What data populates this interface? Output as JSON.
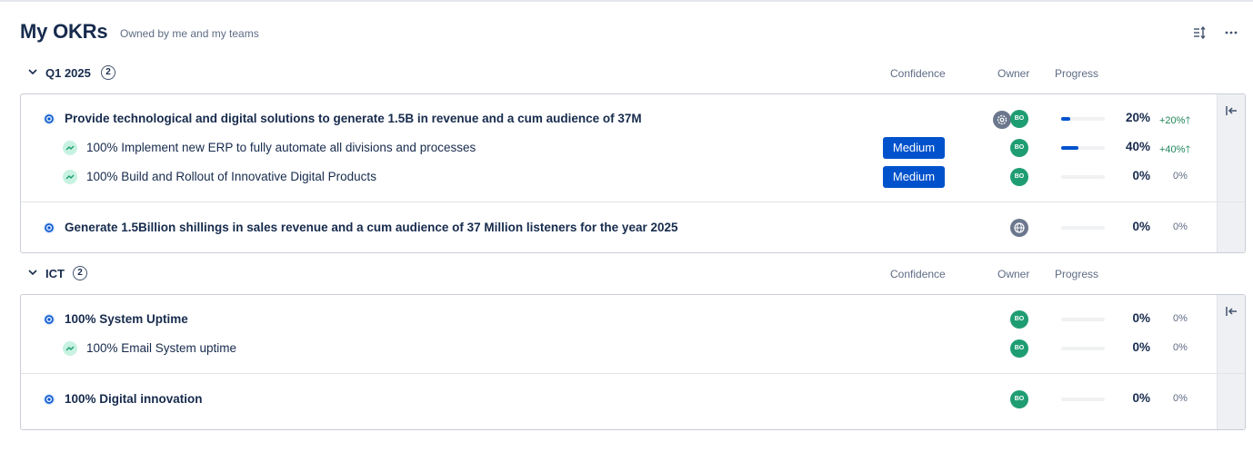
{
  "header": {
    "title": "My OKRs",
    "subtitle": "Owned by me and my teams",
    "sort_icon": "sort-icon",
    "more_icon": "more-horizontal-icon"
  },
  "columns": {
    "confidence": "Confidence",
    "owner": "Owner",
    "progress": "Progress"
  },
  "groups": [
    {
      "name": "Q1 2025",
      "count": "2",
      "objectives": [
        {
          "title": "Provide technological and digital solutions to generate 1.5B in revenue and a cum audience of 37M",
          "owners": [
            {
              "type": "team",
              "text": ""
            },
            {
              "type": "user",
              "text": "BO"
            }
          ],
          "progress": 0.2,
          "progress_label": "20%",
          "delta": "+20%",
          "key_results": [
            {
              "title": "100% Implement new ERP to fully automate all divisions and processes",
              "confidence": "Medium",
              "owner": "BO",
              "progress": 0.4,
              "progress_label": "40%",
              "delta": "+40%"
            },
            {
              "title": "100% Build and Rollout of Innovative Digital Products",
              "confidence": "Medium",
              "owner": "BO",
              "progress": 0,
              "progress_label": "0%",
              "delta": "0%"
            }
          ]
        },
        {
          "title": "Generate 1.5Billion shillings in sales revenue and a cum audience of 37 Million listeners for the year 2025",
          "owners": [
            {
              "type": "org",
              "text": ""
            }
          ],
          "progress": 0,
          "progress_label": "0%",
          "delta": "0%",
          "key_results": []
        }
      ]
    },
    {
      "name": "ICT",
      "count": "2",
      "objectives": [
        {
          "title": "100% System Uptime",
          "owners": [
            {
              "type": "user",
              "text": "BO"
            }
          ],
          "progress": 0,
          "progress_label": "0%",
          "delta": "0%",
          "key_results": [
            {
              "title": "100% Email System uptime",
              "confidence": "",
              "owner": "BO",
              "progress": 0,
              "progress_label": "0%",
              "delta": "0%"
            }
          ]
        },
        {
          "title": "100% Digital innovation",
          "owners": [
            {
              "type": "user",
              "text": "BO"
            }
          ],
          "progress": 0,
          "progress_label": "0%",
          "delta": "0%",
          "key_results": []
        }
      ]
    }
  ],
  "colors": {
    "accent": "#0052cc",
    "positive": "#1f845a",
    "avatar": "#1f9d72",
    "kr_icon_bg": "#c8f2e1"
  }
}
